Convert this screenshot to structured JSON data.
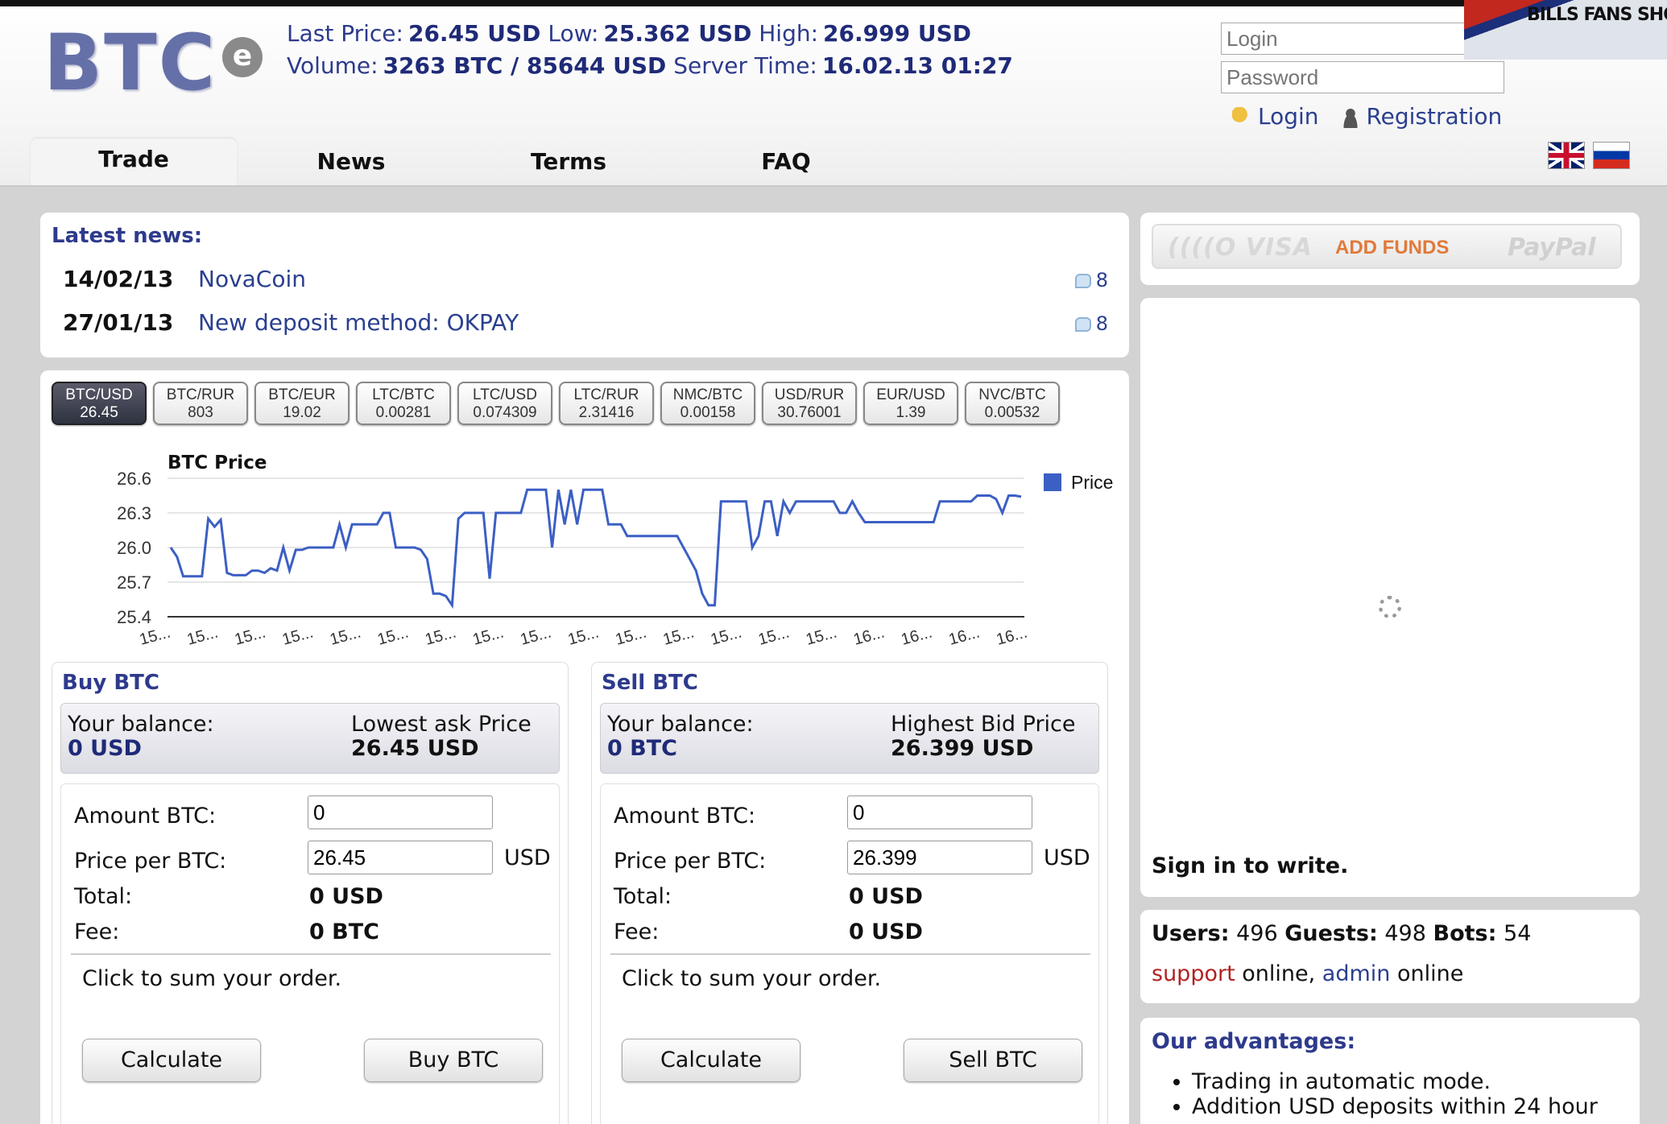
{
  "header": {
    "logo_text": "BTC",
    "logo_badge": "e",
    "last_price_label": "Last Price:",
    "last_price": "26.45 USD",
    "low_label": "Low:",
    "low": "25.362 USD",
    "high_label": "High:",
    "high": "26.999 USD",
    "volume_label": "Volume:",
    "volume": "3263 BTC / 85644 USD",
    "server_time_label": "Server Time:",
    "server_time": "16.02.13 01:27"
  },
  "auth": {
    "login_placeholder": "Login",
    "password_placeholder": "Password",
    "login_link": "Login",
    "registration_link": "Registration"
  },
  "ad": {
    "text": "BILLS FANS SHOVEL S"
  },
  "nav": {
    "tabs": [
      "Trade",
      "News",
      "Terms",
      "FAQ"
    ]
  },
  "news": {
    "heading": "Latest news:",
    "items": [
      {
        "date": "14/02/13",
        "title": "NovaCoin",
        "comments": "8"
      },
      {
        "date": "27/01/13",
        "title": "New deposit method: OKPAY",
        "comments": "8"
      }
    ]
  },
  "pairs": [
    {
      "name": "BTC/USD",
      "price": "26.45"
    },
    {
      "name": "BTC/RUR",
      "price": "803"
    },
    {
      "name": "BTC/EUR",
      "price": "19.02"
    },
    {
      "name": "LTC/BTC",
      "price": "0.00281"
    },
    {
      "name": "LTC/USD",
      "price": "0.074309"
    },
    {
      "name": "LTC/RUR",
      "price": "2.31416"
    },
    {
      "name": "NMC/BTC",
      "price": "0.00158"
    },
    {
      "name": "USD/RUR",
      "price": "30.76001"
    },
    {
      "name": "EUR/USD",
      "price": "1.39"
    },
    {
      "name": "NVC/BTC",
      "price": "0.00532"
    }
  ],
  "chart_data": {
    "type": "line",
    "title": "BTC Price",
    "ylim": [
      25.4,
      26.6
    ],
    "yticks": [
      "26.6",
      "26.3",
      "26.0",
      "25.7",
      "25.4"
    ],
    "xtick_labels": [
      "15...",
      "15...",
      "15...",
      "15...",
      "15...",
      "15...",
      "15...",
      "15...",
      "15...",
      "15...",
      "15...",
      "15...",
      "15...",
      "15...",
      "15...",
      "16...",
      "16...",
      "16...",
      "16..."
    ],
    "series": [
      {
        "name": "Price",
        "color": "#3c5fc4",
        "values": [
          26.0,
          25.92,
          25.75,
          25.75,
          25.75,
          25.75,
          26.25,
          26.18,
          26.24,
          25.78,
          25.76,
          25.76,
          25.76,
          25.8,
          25.8,
          25.78,
          25.82,
          25.8,
          26.0,
          25.8,
          25.98,
          25.98,
          26.0,
          26.0,
          26.0,
          26.0,
          26.0,
          26.2,
          26.0,
          26.2,
          26.2,
          26.2,
          26.2,
          26.2,
          26.3,
          26.3,
          26.0,
          26.0,
          26.0,
          26.0,
          25.98,
          25.9,
          25.6,
          25.6,
          25.58,
          25.5,
          26.25,
          26.3,
          26.3,
          26.3,
          26.3,
          25.73,
          26.3,
          26.3,
          26.3,
          26.3,
          26.3,
          26.5,
          26.5,
          26.5,
          26.5,
          26.0,
          26.5,
          26.2,
          26.5,
          26.2,
          26.5,
          26.5,
          26.5,
          26.5,
          26.2,
          26.2,
          26.2,
          26.1,
          26.1,
          26.1,
          26.1,
          26.1,
          26.1,
          26.1,
          26.1,
          26.1,
          26.0,
          25.9,
          25.8,
          25.6,
          25.5,
          25.5,
          26.4,
          26.4,
          26.4,
          26.4,
          26.4,
          26.0,
          26.1,
          26.4,
          26.4,
          26.1,
          26.4,
          26.3,
          26.4,
          26.4,
          26.4,
          26.4,
          26.4,
          26.4,
          26.4,
          26.3,
          26.3,
          26.4,
          26.3,
          26.22,
          26.22,
          26.22,
          26.22,
          26.22,
          26.22,
          26.22,
          26.22,
          26.22,
          26.22,
          26.22,
          26.22,
          26.4,
          26.4,
          26.4,
          26.4,
          26.4,
          26.4,
          26.45,
          26.45,
          26.45,
          26.42,
          26.3,
          26.45,
          26.45,
          26.44
        ]
      }
    ],
    "legend": "right",
    "grid": true
  },
  "buy": {
    "heading": "Buy BTC",
    "balance_label": "Your balance:",
    "balance_value": "0 USD",
    "price_label": "Lowest ask Price",
    "price_value": "26.45 USD",
    "amount_label": "Amount BTC:",
    "amount_value": "0",
    "price_per_label": "Price per BTC:",
    "price_per_value": "26.45",
    "unit": "USD",
    "total_label": "Total:",
    "total_value": "0 USD",
    "fee_label": "Fee:",
    "fee_value": "0 BTC",
    "hint": "Click to sum your order.",
    "calc_button": "Calculate",
    "action_button": "Buy BTC"
  },
  "sell": {
    "heading": "Sell BTC",
    "balance_label": "Your balance:",
    "balance_value": "0 BTC",
    "price_label": "Highest Bid Price",
    "price_value": "26.399 USD",
    "amount_label": "Amount BTC:",
    "amount_value": "0",
    "price_per_label": "Price per BTC:",
    "price_per_value": "26.399",
    "unit": "USD",
    "total_label": "Total:",
    "total_value": "0 USD",
    "fee_label": "Fee:",
    "fee_value": "0 USD",
    "hint": "Click to sum your order.",
    "calc_button": "Calculate",
    "action_button": "Sell BTC"
  },
  "funds": {
    "visa": "((((O VISA",
    "label": "ADD FUNDS",
    "paypal": "PayPal"
  },
  "chat": {
    "signin": "Sign in to write."
  },
  "online": {
    "users_label": "Users:",
    "users": "496",
    "guests_label": "Guests:",
    "guests": "498",
    "bots_label": "Bots:",
    "bots": "54",
    "support": "support",
    "support_status": "online",
    "admin": "admin",
    "admin_status": "online"
  },
  "advantages": {
    "heading": "Our advantages:",
    "items": [
      "Trading in automatic mode.",
      "Addition USD deposits within 24 hour"
    ]
  }
}
